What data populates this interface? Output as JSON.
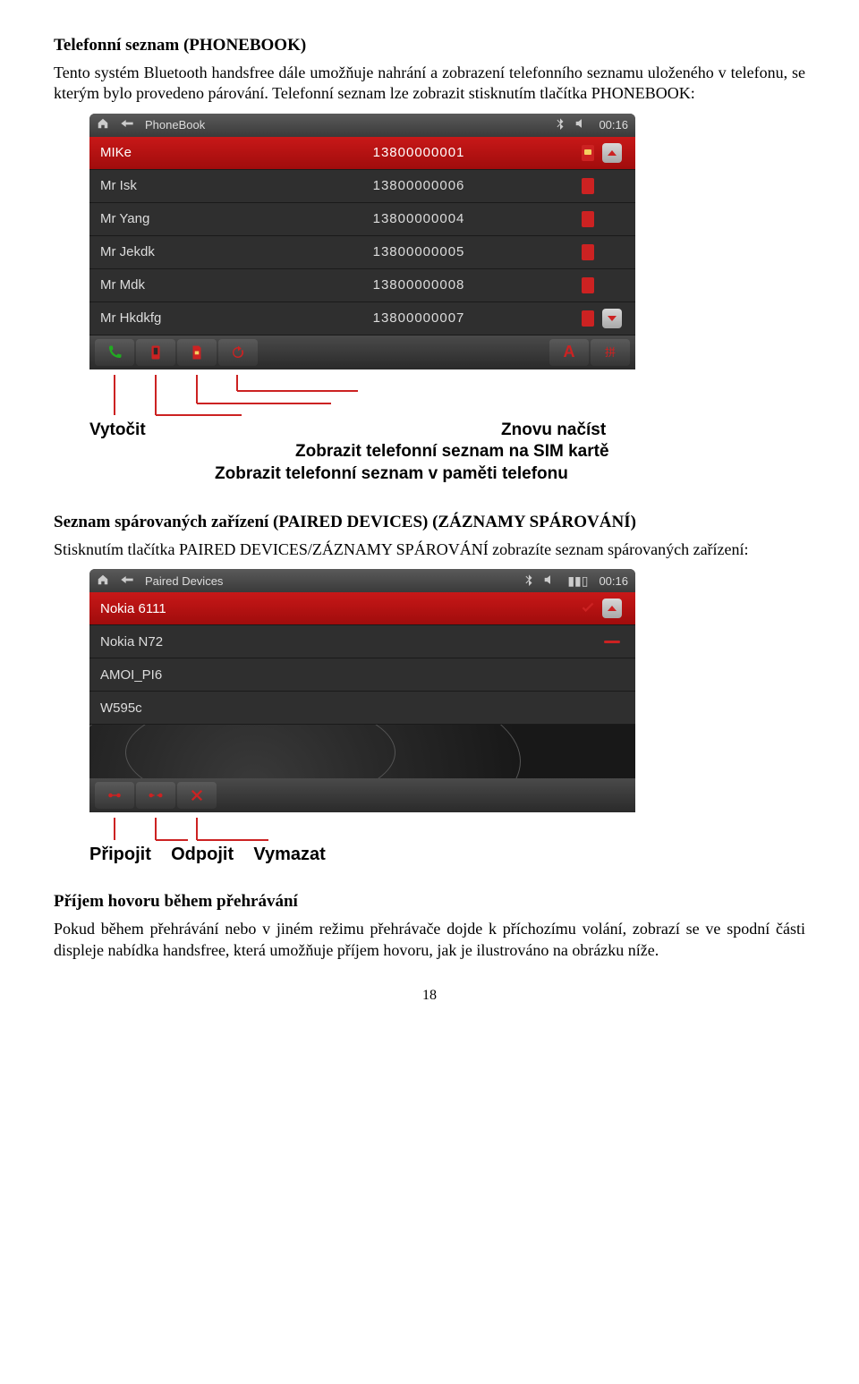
{
  "section1": {
    "heading": "Telefonní seznam (PHONEBOOK)",
    "para": "Tento systém Bluetooth handsfree dále umožňuje nahrání a zobrazení telefonního seznamu uloženého v telefonu, se kterým bylo provedeno párování. Telefonní seznam lze zobrazit stisknutím tlačítka PHONEBOOK:"
  },
  "phonebook": {
    "title": "PhoneBook",
    "clock": "00:16",
    "rows": [
      {
        "name": "MIKe",
        "num": "13800000001",
        "sim": true,
        "selected": true
      },
      {
        "name": "Mr Isk",
        "num": "13800000006",
        "sim": false,
        "selected": false
      },
      {
        "name": "Mr Yang",
        "num": "13800000004",
        "sim": false,
        "selected": false
      },
      {
        "name": "Mr Jekdk",
        "num": "13800000005",
        "sim": false,
        "selected": false
      },
      {
        "name": "Mr Mdk",
        "num": "13800000008",
        "sim": false,
        "selected": false
      },
      {
        "name": "Mr Hkdkfg",
        "num": "13800000007",
        "sim": false,
        "selected": false
      }
    ],
    "callouts": {
      "dial": "Vytočit",
      "reload": "Znovu načíst",
      "sim": "Zobrazit telefonní seznam na SIM kartě",
      "phone": "Zobrazit telefonní seznam v paměti telefonu"
    }
  },
  "section2": {
    "heading": "Seznam spárovaných zařízení (PAIRED DEVICES) (ZÁZNAMY SPÁROVÁNÍ)",
    "para": "Stisknutím tlačítka PAIRED DEVICES/ZÁZNAMY SPÁROVÁNÍ zobrazíte seznam spárovaných zařízení:"
  },
  "paired": {
    "title": "Paired Devices",
    "clock": "00:16",
    "rows": [
      {
        "name": "Nokia 6111",
        "selected": true,
        "check": true
      },
      {
        "name": "Nokia N72",
        "selected": false,
        "check": false
      },
      {
        "name": "AMOI_PI6",
        "selected": false,
        "check": false
      },
      {
        "name": "W595c",
        "selected": false,
        "check": false
      }
    ],
    "callouts": {
      "connect": "Připojit",
      "disconnect": "Odpojit",
      "delete": "Vymazat"
    }
  },
  "section3": {
    "heading": "Příjem hovoru během přehrávání",
    "para": "Pokud během přehrávání nebo v jiném režimu přehrávače dojde k příchozímu volání, zobrazí se ve spodní části displeje nabídka handsfree, která umožňuje příjem hovoru, jak je ilustrováno na obrázku níže."
  },
  "pagenum": "18"
}
